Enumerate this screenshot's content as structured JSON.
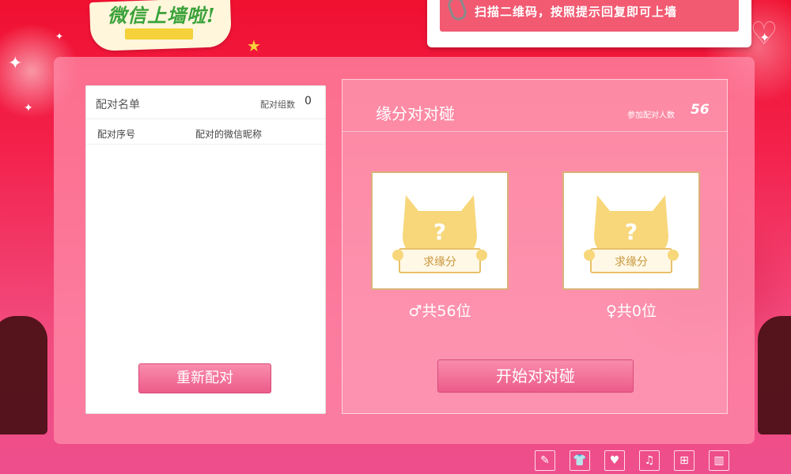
{
  "logo": {
    "text": "微信上墙啦!",
    "icon": "star-icon"
  },
  "banner": {
    "text": "扫描二维码，按照提示回复即可上墙",
    "icon": "paperclip-icon"
  },
  "pair_list": {
    "title": "配对名单",
    "count_label": "配对组数",
    "count": "0",
    "columns": [
      "配对序号",
      "配对的微信昵称"
    ],
    "rows": [],
    "rematch_label": "重新配对"
  },
  "match": {
    "title": "缘分对对碰",
    "participants_label": "参加配对人数",
    "participants_count": "56",
    "male": {
      "placeholder_sign": "求缘分",
      "count_text": "♂共56位"
    },
    "female": {
      "placeholder_sign": "求缘分",
      "count_text": "♀共0位"
    },
    "start_label": "开始对对碰"
  },
  "toolbar": {
    "icons": [
      "pen-icon",
      "shirt-icon",
      "hearts-icon",
      "music-icon",
      "gift-icon",
      "bar-chart-icon"
    ]
  },
  "colors": {
    "accent_pink": "#ec5c8a",
    "background_red": "#f01030",
    "avatar_yellow": "#f7d77a"
  }
}
